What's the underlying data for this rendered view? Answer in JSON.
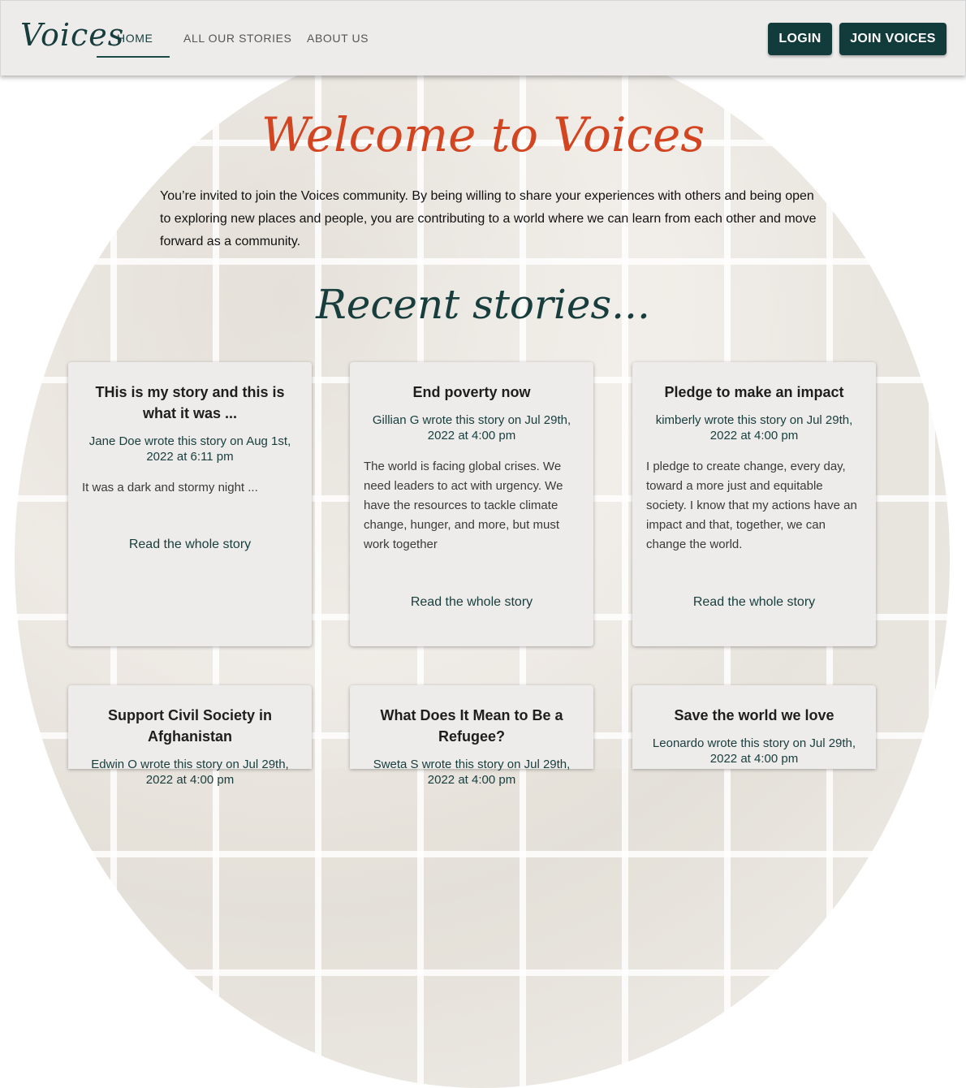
{
  "header": {
    "logo": "Voices",
    "nav": [
      {
        "label": "HOME",
        "active": true
      },
      {
        "label": "ALL OUR STORIES",
        "active": false
      },
      {
        "label": "ABOUT US",
        "active": false
      }
    ],
    "login_label": "LOGIN",
    "join_label": "JOIN VOICES"
  },
  "hero": {
    "title": "Welcome to Voices",
    "intro": "You’re invited to join the Voices community. By being willing to share your experiences with others and being open to exploring new places and people, you are contributing to a world where we can learn from each other and move forward as a community."
  },
  "recent": {
    "heading": "Recent stories...",
    "link_label": "Read the whole story",
    "stories": [
      {
        "title": "THis is my story and this is what it was ...",
        "meta": "Jane Doe wrote this story on Aug 1st, 2022 at 6:11 pm",
        "body": "It was a dark and stormy night ..."
      },
      {
        "title": "End poverty now",
        "meta": "Gillian G wrote this story on Jul 29th, 2022 at 4:00 pm",
        "body": "The world is facing global crises. We need leaders to act with urgency. We have the resources to tackle climate change, hunger, and more, but must work together"
      },
      {
        "title": "Pledge to make an impact",
        "meta": "kimberly wrote this story on Jul 29th, 2022 at 4:00 pm",
        "body": "I pledge to create change, every day, toward a more just and equitable society. I know that my actions have an impact and that, together, we can change the world."
      },
      {
        "title": "Support Civil Society in Afghanistan",
        "meta": "Edwin O wrote this story on Jul 29th, 2022 at 4:00 pm",
        "body": ""
      },
      {
        "title": "What Does It Mean to Be a Refugee?",
        "meta": "Sweta S wrote this story on Jul 29th, 2022 at 4:00 pm",
        "body": ""
      },
      {
        "title": "Save the world we love",
        "meta": "Leonardo wrote this story on Jul 29th, 2022 at 4:00 pm",
        "body": ""
      }
    ]
  },
  "colors": {
    "brand_dark": "#123b3b",
    "accent": "#d24520",
    "header_bg": "#eeeceb",
    "card_bg": "#eeecea"
  }
}
